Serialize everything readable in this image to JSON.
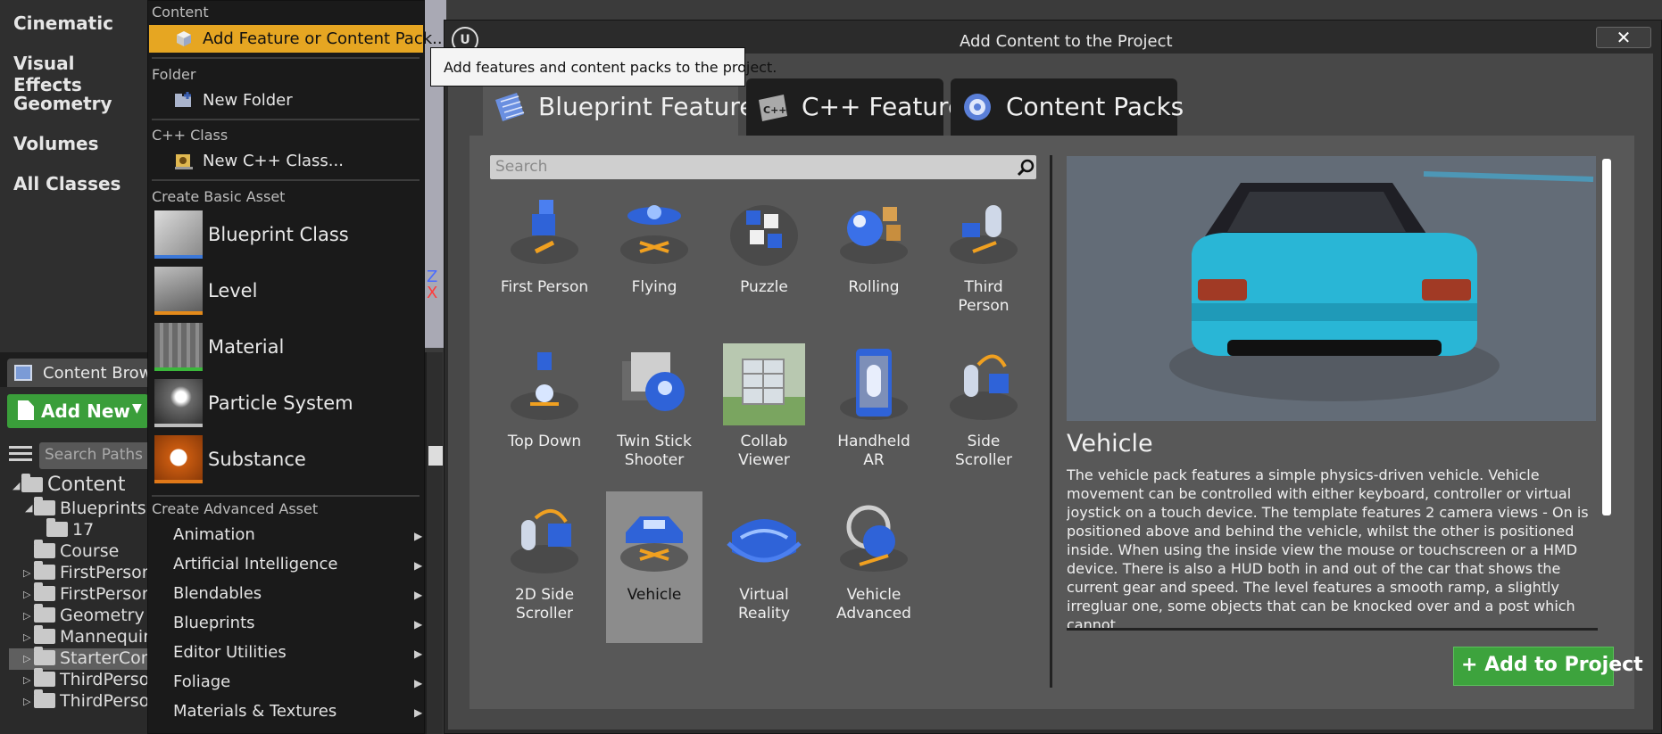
{
  "left_panel": {
    "items": [
      "Cinematic",
      "Visual Effects",
      "Geometry",
      "Volumes",
      "All Classes"
    ]
  },
  "viewport": {
    "axis_z": "Z",
    "axis_x": "X"
  },
  "content_browser": {
    "tab_label": "Content Brows",
    "add_new_label": "Add New",
    "search_paths_placeholder": "Search Paths",
    "tree": [
      {
        "label": "Content"
      },
      {
        "label": "Blueprints"
      },
      {
        "label": "17"
      },
      {
        "label": "Course"
      },
      {
        "label": "FirstPerson"
      },
      {
        "label": "FirstPerson"
      },
      {
        "label": "Geometry"
      },
      {
        "label": "Mannequin"
      },
      {
        "label": "StarterCon"
      },
      {
        "label": "ThirdPerso"
      },
      {
        "label": "ThirdPerso"
      }
    ]
  },
  "context_menu": {
    "sections": {
      "content": "Content",
      "folder": "Folder",
      "cpp_class": "C++ Class",
      "basic": "Create Basic Asset",
      "advanced": "Create Advanced Asset"
    },
    "add_feature": "Add Feature or Content Pack...",
    "new_folder": "New Folder",
    "new_cpp_class": "New C++ Class...",
    "basic_assets": [
      "Blueprint Class",
      "Level",
      "Material",
      "Particle System",
      "Substance"
    ],
    "advanced_assets": [
      "Animation",
      "Artificial Intelligence",
      "Blendables",
      "Blueprints",
      "Editor Utilities",
      "Foliage",
      "Materials & Textures"
    ]
  },
  "tooltip": "Add features and content packs to the project.",
  "dialog": {
    "title": "Add Content to the Project",
    "close_label": "✕",
    "tabs": [
      "Blueprint Feature",
      "C++ Feature",
      "Content Packs"
    ],
    "search_placeholder": "Search",
    "templates": [
      {
        "label": "First Person"
      },
      {
        "label": "Flying"
      },
      {
        "label": "Puzzle"
      },
      {
        "label": "Rolling"
      },
      {
        "label": "Third\nPerson"
      },
      {
        "label": "Top Down"
      },
      {
        "label": "Twin Stick\nShooter"
      },
      {
        "label": "Collab\nViewer"
      },
      {
        "label": "Handheld\nAR"
      },
      {
        "label": "Side\nScroller"
      },
      {
        "label": "2D Side\nScroller"
      },
      {
        "label": "Vehicle"
      },
      {
        "label": "Virtual\nReality"
      },
      {
        "label": "Vehicle\nAdvanced"
      }
    ],
    "selected_template": "Vehicle",
    "detail_title": "Vehicle",
    "detail_text": "The vehicle pack features a simple physics-driven vehicle. Vehicle movement can be controlled with either keyboard, controller or virtual joystick on a touch device. The template features 2 camera views - On is positioned above and behind the vehicle, whilst the other is positioned inside. When using the inside view the mouse or touchscreen or a HMD device. There is also a HUD both in and out of the car that shows the current gear and speed. The level features a smooth ramp, a slightly irregluar one, some objects that can be knocked over and a post which cannot",
    "add_button": "Add to Project"
  },
  "colors": {
    "menu_highlight": "#e6a622",
    "add_green": "#3da33d",
    "car_body": "#29b6d6"
  }
}
